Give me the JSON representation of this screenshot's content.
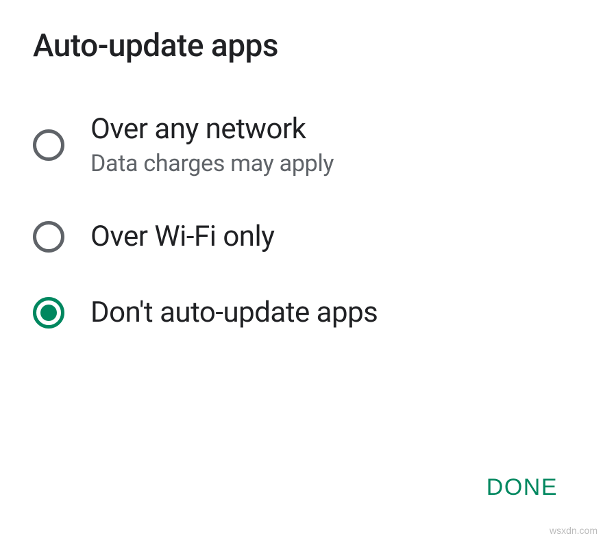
{
  "dialog": {
    "title": "Auto-update apps",
    "options": [
      {
        "label": "Over any network",
        "sublabel": "Data charges may apply",
        "selected": false
      },
      {
        "label": "Over Wi-Fi only",
        "sublabel": "",
        "selected": false
      },
      {
        "label": "Don't auto-update apps",
        "sublabel": "",
        "selected": true
      }
    ],
    "done_label": "DONE"
  },
  "watermark": "wsxdn.com"
}
